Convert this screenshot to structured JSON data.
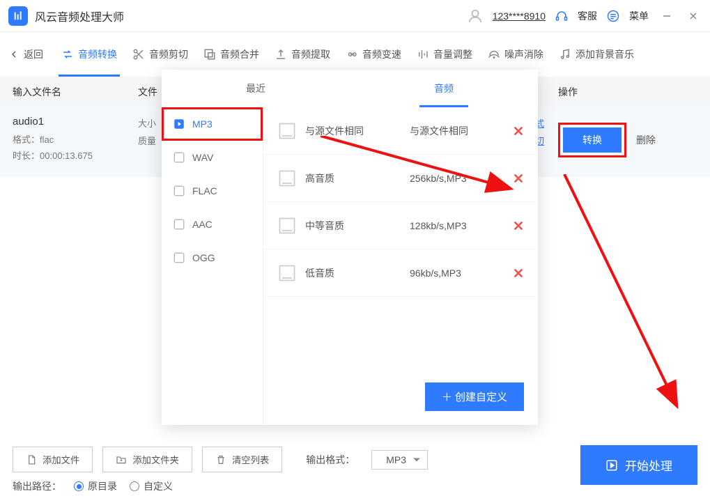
{
  "title_bar": {
    "app_name": "风云音频处理大师",
    "user_id": "123****8910",
    "service": "客服",
    "menu": "菜单"
  },
  "toolbar": {
    "back": "返回",
    "items": [
      {
        "label": "音频转换",
        "active": true
      },
      {
        "label": "音频剪切"
      },
      {
        "label": "音频合并"
      },
      {
        "label": "音频提取"
      },
      {
        "label": "音频变速"
      },
      {
        "label": "音量调整"
      },
      {
        "label": "噪声消除"
      },
      {
        "label": "添加背景音乐"
      }
    ]
  },
  "table": {
    "col_name": "输入文件名",
    "col_info": "文件",
    "col_out": "操作"
  },
  "row": {
    "name": "audio1",
    "format_label": "格式：",
    "format_value": "flac",
    "duration_label": "时长：",
    "duration_value": "00:00:13.675",
    "size_label": "大小",
    "quality_label": "质量",
    "out_format_link": "出格式",
    "out_cut_link": "频剪切",
    "convert_btn": "转换",
    "delete": "删除"
  },
  "panel": {
    "tab_recent": "最近",
    "tab_audio": "音频",
    "formats": [
      {
        "name": "MP3",
        "active": true
      },
      {
        "name": "WAV"
      },
      {
        "name": "FLAC"
      },
      {
        "name": "AAC"
      },
      {
        "name": "OGG"
      }
    ],
    "qualities": [
      {
        "label": "与源文件相同",
        "value": "与源文件相同"
      },
      {
        "label": "高音质",
        "value": "256kb/s,MP3"
      },
      {
        "label": "中等音质",
        "value": "128kb/s,MP3"
      },
      {
        "label": "低音质",
        "value": "96kb/s,MP3"
      }
    ],
    "custom_btn": "＋ 创建自定义"
  },
  "bottom": {
    "add_file": "添加文件",
    "add_folder": "添加文件夹",
    "clear": "清空列表",
    "out_format_label": "输出格式：",
    "out_format_value": "MP3",
    "start": "开始处理",
    "out_path_label": "输出路径：",
    "radio_original": "原目录",
    "radio_custom": "自定义"
  }
}
